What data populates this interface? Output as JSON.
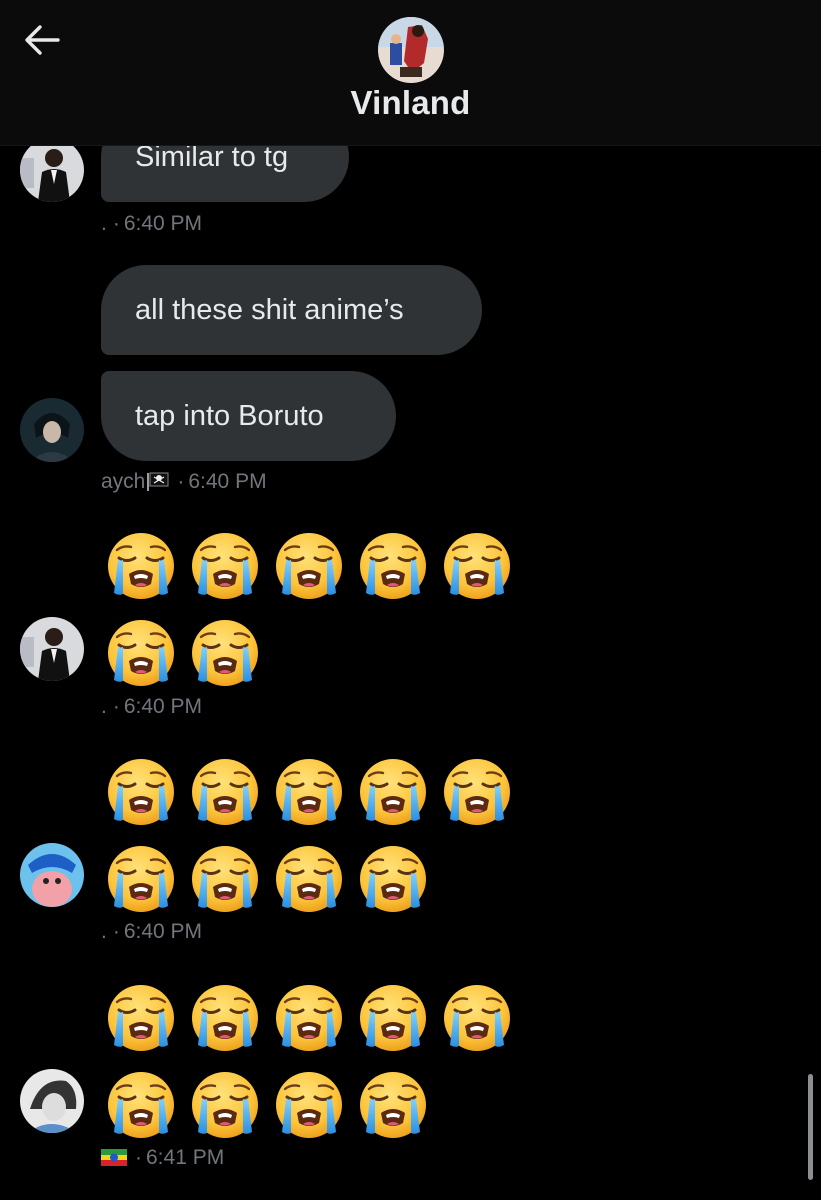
{
  "header": {
    "title": "Vinland",
    "back_icon": "arrow-left-icon"
  },
  "messages": [
    {
      "text": "Similar to tg"
    },
    {
      "meta_sender": ".",
      "meta_time": "6:40 PM"
    },
    {
      "text": "all these shit anime’s"
    },
    {
      "text": "tap into Boruto"
    },
    {
      "meta_sender": "aych",
      "meta_time": "6:40 PM"
    },
    {
      "emoji": "😭",
      "rows": [
        5,
        2
      ],
      "meta_sender": ".",
      "meta_time": "6:40 PM"
    },
    {
      "emoji": "😭",
      "rows": [
        5,
        4
      ],
      "meta_sender": ".",
      "meta_time": "6:40 PM"
    },
    {
      "emoji": "😭",
      "rows": [
        5,
        4
      ],
      "meta_sender": "",
      "meta_time": "6:41 PM"
    }
  ],
  "colors": {
    "background": "#000000",
    "bubble": "#2f3336",
    "text": "#e7e9ea",
    "meta": "#71767b"
  }
}
